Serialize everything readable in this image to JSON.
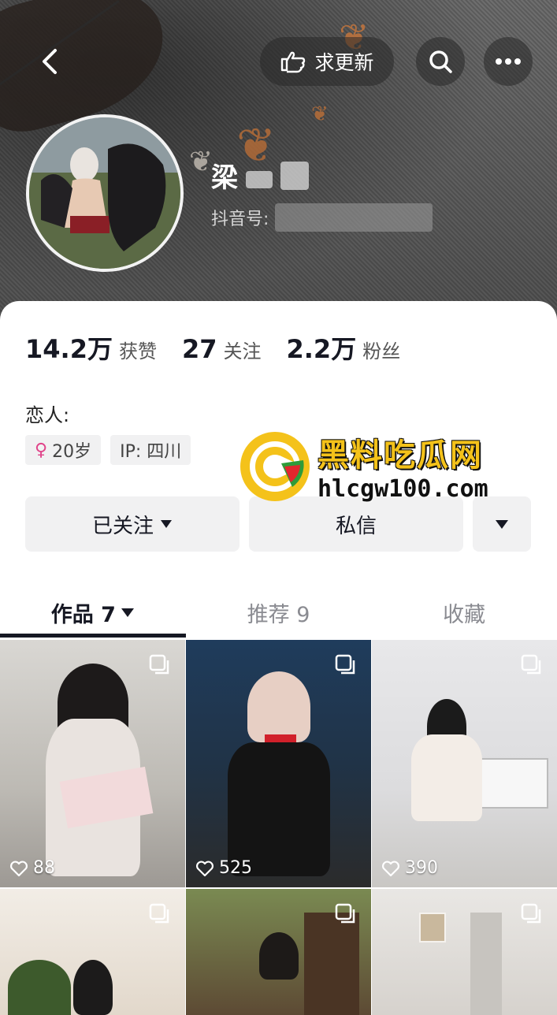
{
  "header": {
    "update_label": "求更新",
    "nickname_visible": "梁",
    "douyin_id_label": "抖音号:"
  },
  "stats": [
    {
      "value": "14.2万",
      "label": "获赞"
    },
    {
      "value": "27",
      "label": "关注"
    },
    {
      "value": "2.2万",
      "label": "粉丝"
    }
  ],
  "bio": "恋人:",
  "tags": {
    "age": "20岁",
    "ip": "IP: 四川"
  },
  "actions": {
    "follow_label": "已关注",
    "message_label": "私信"
  },
  "tabs": [
    {
      "label": "作品 7",
      "active": true
    },
    {
      "label": "推荐 9",
      "active": false
    },
    {
      "label": "收藏",
      "active": false
    }
  ],
  "posts": [
    {
      "likes": "88"
    },
    {
      "likes": "525"
    },
    {
      "likes": "390"
    }
  ],
  "watermark": {
    "title": "黑料吃瓜网",
    "url": "hlcgw100.com"
  },
  "icons": {
    "back": "chevron-left-icon",
    "update": "hand-point-icon",
    "search": "search-icon",
    "more": "more-dots-icon",
    "female": "female-icon",
    "dropdown": "caret-down-icon",
    "multi_image": "multi-image-icon",
    "like": "heart-icon"
  },
  "colors": {
    "accent_watermark": "#f4c21a",
    "female": "#e0448a",
    "button_bg": "#f1f1f2"
  }
}
